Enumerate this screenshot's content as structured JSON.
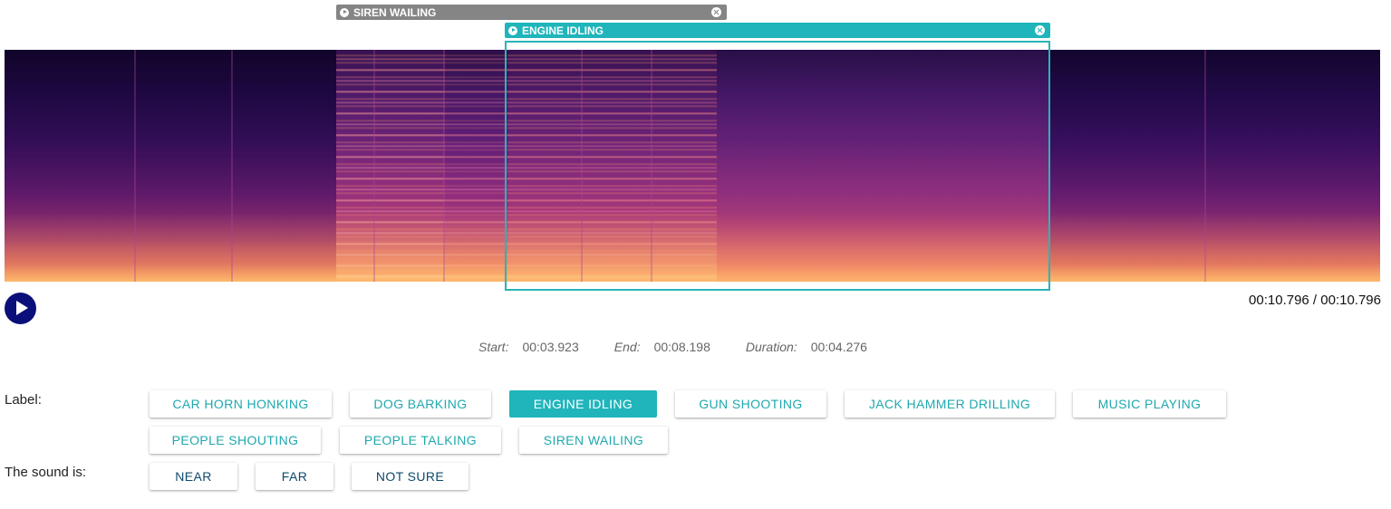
{
  "regions": [
    {
      "label": "SIREN WAILING",
      "color": "#858585"
    },
    {
      "label": "ENGINE IDLING",
      "color": "#1fb5bb"
    }
  ],
  "player": {
    "time_readout": "00:10.796 / 00:10.796"
  },
  "selection": {
    "start_label": "Start:",
    "start_value": "00:03.923",
    "end_label": "End:",
    "end_value": "00:08.198",
    "duration_label": "Duration:",
    "duration_value": "00:04.276"
  },
  "label_section": {
    "heading": "Label:",
    "selected": "ENGINE IDLING",
    "options": [
      "CAR HORN HONKING",
      "DOG BARKING",
      "ENGINE IDLING",
      "GUN SHOOTING",
      "JACK HAMMER DRILLING",
      "MUSIC PLAYING",
      "PEOPLE SHOUTING",
      "PEOPLE TALKING",
      "SIREN WAILING"
    ]
  },
  "proximity_section": {
    "heading": "The sound is:",
    "options": [
      "NEAR",
      "FAR",
      "NOT SURE"
    ]
  },
  "colors": {
    "accent": "#1fb5bb",
    "play_button": "#0a0f7a"
  },
  "icons": {
    "play": "play-icon",
    "region_play": "play-circle-icon",
    "region_close": "close-circle-icon"
  }
}
